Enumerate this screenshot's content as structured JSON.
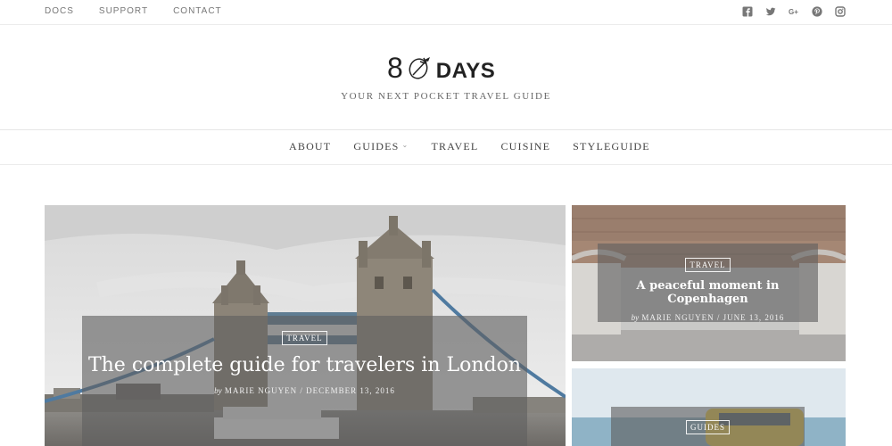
{
  "topbar": {
    "links": [
      "DOCS",
      "SUPPORT",
      "CONTACT"
    ],
    "social_icons": [
      "facebook-icon",
      "twitter-icon",
      "google-plus-icon",
      "pinterest-icon",
      "instagram-icon"
    ]
  },
  "header": {
    "logo_number": "8",
    "logo_word": "DAYS",
    "tagline": "YOUR NEXT POCKET TRAVEL GUIDE"
  },
  "nav": {
    "items": [
      "ABOUT",
      "GUIDES",
      "TRAVEL",
      "CUISINE",
      "STYLEGUIDE"
    ]
  },
  "posts": [
    {
      "category": "TRAVEL",
      "title": "The complete guide for travelers in London",
      "by": "by",
      "author": "MARIE NGUYEN",
      "date": "DECEMBER 13, 2016"
    },
    {
      "category": "TRAVEL",
      "title": "A peaceful moment in Copenhagen",
      "by": "by",
      "author": "MARIE NGUYEN",
      "date": "JUNE 13, 2016"
    },
    {
      "category": "GUIDES"
    }
  ]
}
